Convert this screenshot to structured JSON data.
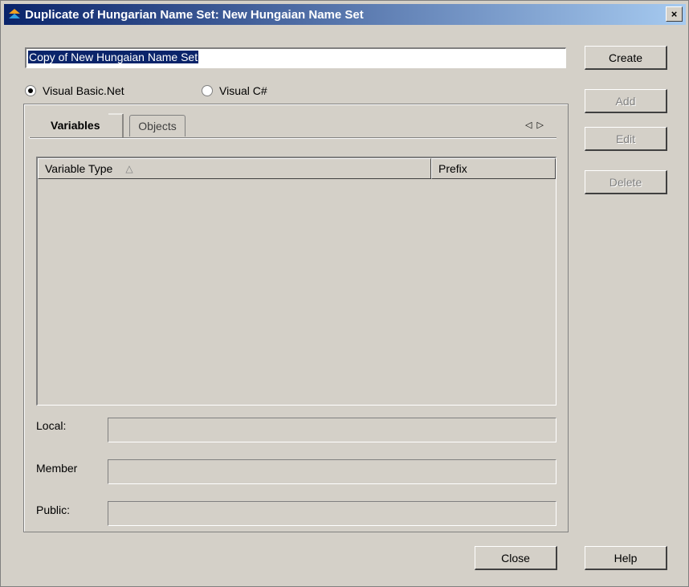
{
  "window": {
    "title": "Duplicate of Hungarian Name Set: New Hungaian Name Set",
    "close_glyph": "×"
  },
  "name_input": {
    "value": "Copy of New Hungaian Name Set"
  },
  "language": {
    "options": [
      {
        "label": "Visual Basic.Net",
        "mnemonic": "B",
        "checked": true
      },
      {
        "label": "Visual C#",
        "mnemonic": "i",
        "checked": false
      }
    ]
  },
  "tabs": [
    {
      "label": "Variables",
      "active": true
    },
    {
      "label": "Objects",
      "active": false
    }
  ],
  "tab_scroll": {
    "left": "◁",
    "right": "▷"
  },
  "list": {
    "columns": [
      {
        "label": "Variable Type",
        "sort_indicator": "△"
      },
      {
        "label": "Prefix"
      }
    ],
    "rows": []
  },
  "fields": [
    {
      "label": "Local:",
      "value": ""
    },
    {
      "label": "Member",
      "value": ""
    },
    {
      "label": "Public:",
      "value": ""
    }
  ],
  "side_buttons": {
    "create": "Create",
    "add": "Add",
    "edit": "Edit",
    "delete": "Delete"
  },
  "bottom_buttons": {
    "close": "Close",
    "help": "Help"
  },
  "colors": {
    "titlebar_start": "#0a246a",
    "titlebar_end": "#a6caf0",
    "selection": "#0a246a",
    "face": "#d4d0c8"
  }
}
